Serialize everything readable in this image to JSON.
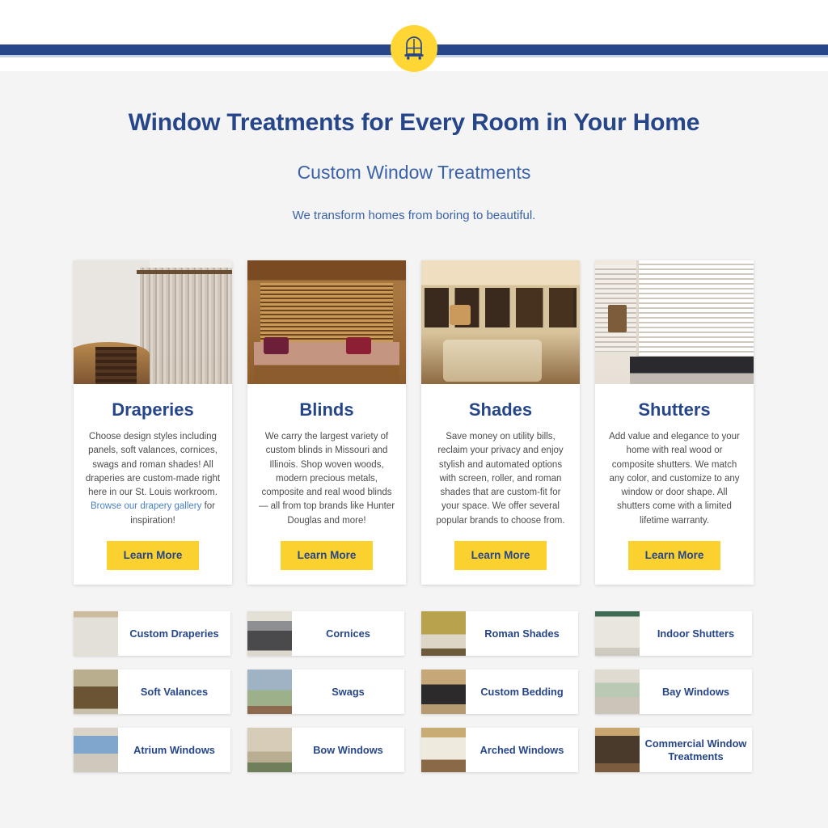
{
  "header": {
    "logo_icon": "arched-window-icon",
    "bar_color": "#27468a",
    "logo_bg_color": "#ffd634"
  },
  "hero": {
    "title": "Window Treatments for Every Room in Your Home",
    "subtitle": "Custom Window Treatments",
    "tagline": "We transform homes from boring to beautiful."
  },
  "cards": [
    {
      "title": "Draperies",
      "desc_before_link": "Choose design styles including panels, soft valances, cornices, swags and roman shades! All draperies are custom-made right here in our St. Louis workroom. ",
      "link_text": "Browse our drapery gallery",
      "desc_after_link": " for inspiration!",
      "button": "Learn More",
      "photo": "draperies-room-photo"
    },
    {
      "title": "Blinds",
      "desc": "We carry the largest variety of custom blinds in Missouri and Illinois. Shop woven woods, modern precious metals, composite and real wood blinds — all from top brands like Hunter Douglas and more!",
      "button": "Learn More",
      "photo": "blinds-bay-window-photo"
    },
    {
      "title": "Shades",
      "desc": "Save money on utility bills, reclaim your privacy and enjoy stylish and automated options with screen, roller, and roman shades that are custom-fit for your space. We offer several popular brands to choose from.",
      "button": "Learn More",
      "photo": "shades-living-room-photo"
    },
    {
      "title": "Shutters",
      "desc": "Add value and elegance to your home with real wood or composite shutters. We match any color, and customize to any window or door shape. All shutters come with a limited lifetime warranty.",
      "button": "Learn More",
      "photo": "shutters-room-photo"
    }
  ],
  "tiles": [
    {
      "label": "Custom Draperies",
      "thumb": "custom-draperies-thumb",
      "art": "t-drape"
    },
    {
      "label": "Cornices",
      "thumb": "cornices-thumb",
      "art": "t-cornice"
    },
    {
      "label": "Roman Shades",
      "thumb": "roman-shades-thumb",
      "art": "t-roman"
    },
    {
      "label": "Indoor Shutters",
      "thumb": "indoor-shutters-thumb",
      "art": "t-indoor"
    },
    {
      "label": "Soft Valances",
      "thumb": "soft-valances-thumb",
      "art": "t-valance"
    },
    {
      "label": "Swags",
      "thumb": "swags-thumb",
      "art": "t-swags"
    },
    {
      "label": "Custom Bedding",
      "thumb": "custom-bedding-thumb",
      "art": "t-bedding"
    },
    {
      "label": "Bay Windows",
      "thumb": "bay-windows-thumb",
      "art": "t-bay"
    },
    {
      "label": "Atrium Windows",
      "thumb": "atrium-windows-thumb",
      "art": "t-atrium"
    },
    {
      "label": "Bow Windows",
      "thumb": "bow-windows-thumb",
      "art": "t-bow"
    },
    {
      "label": "Arched Windows",
      "thumb": "arched-windows-thumb",
      "art": "t-arched"
    },
    {
      "label": "Commercial Window Treatments",
      "thumb": "commercial-window-treatments-thumb",
      "art": "t-commercial"
    }
  ],
  "colors": {
    "navy": "#27468a",
    "yellow": "#fbd130",
    "link_blue": "#4a7fc4",
    "page_bg": "#f4f4f4"
  }
}
